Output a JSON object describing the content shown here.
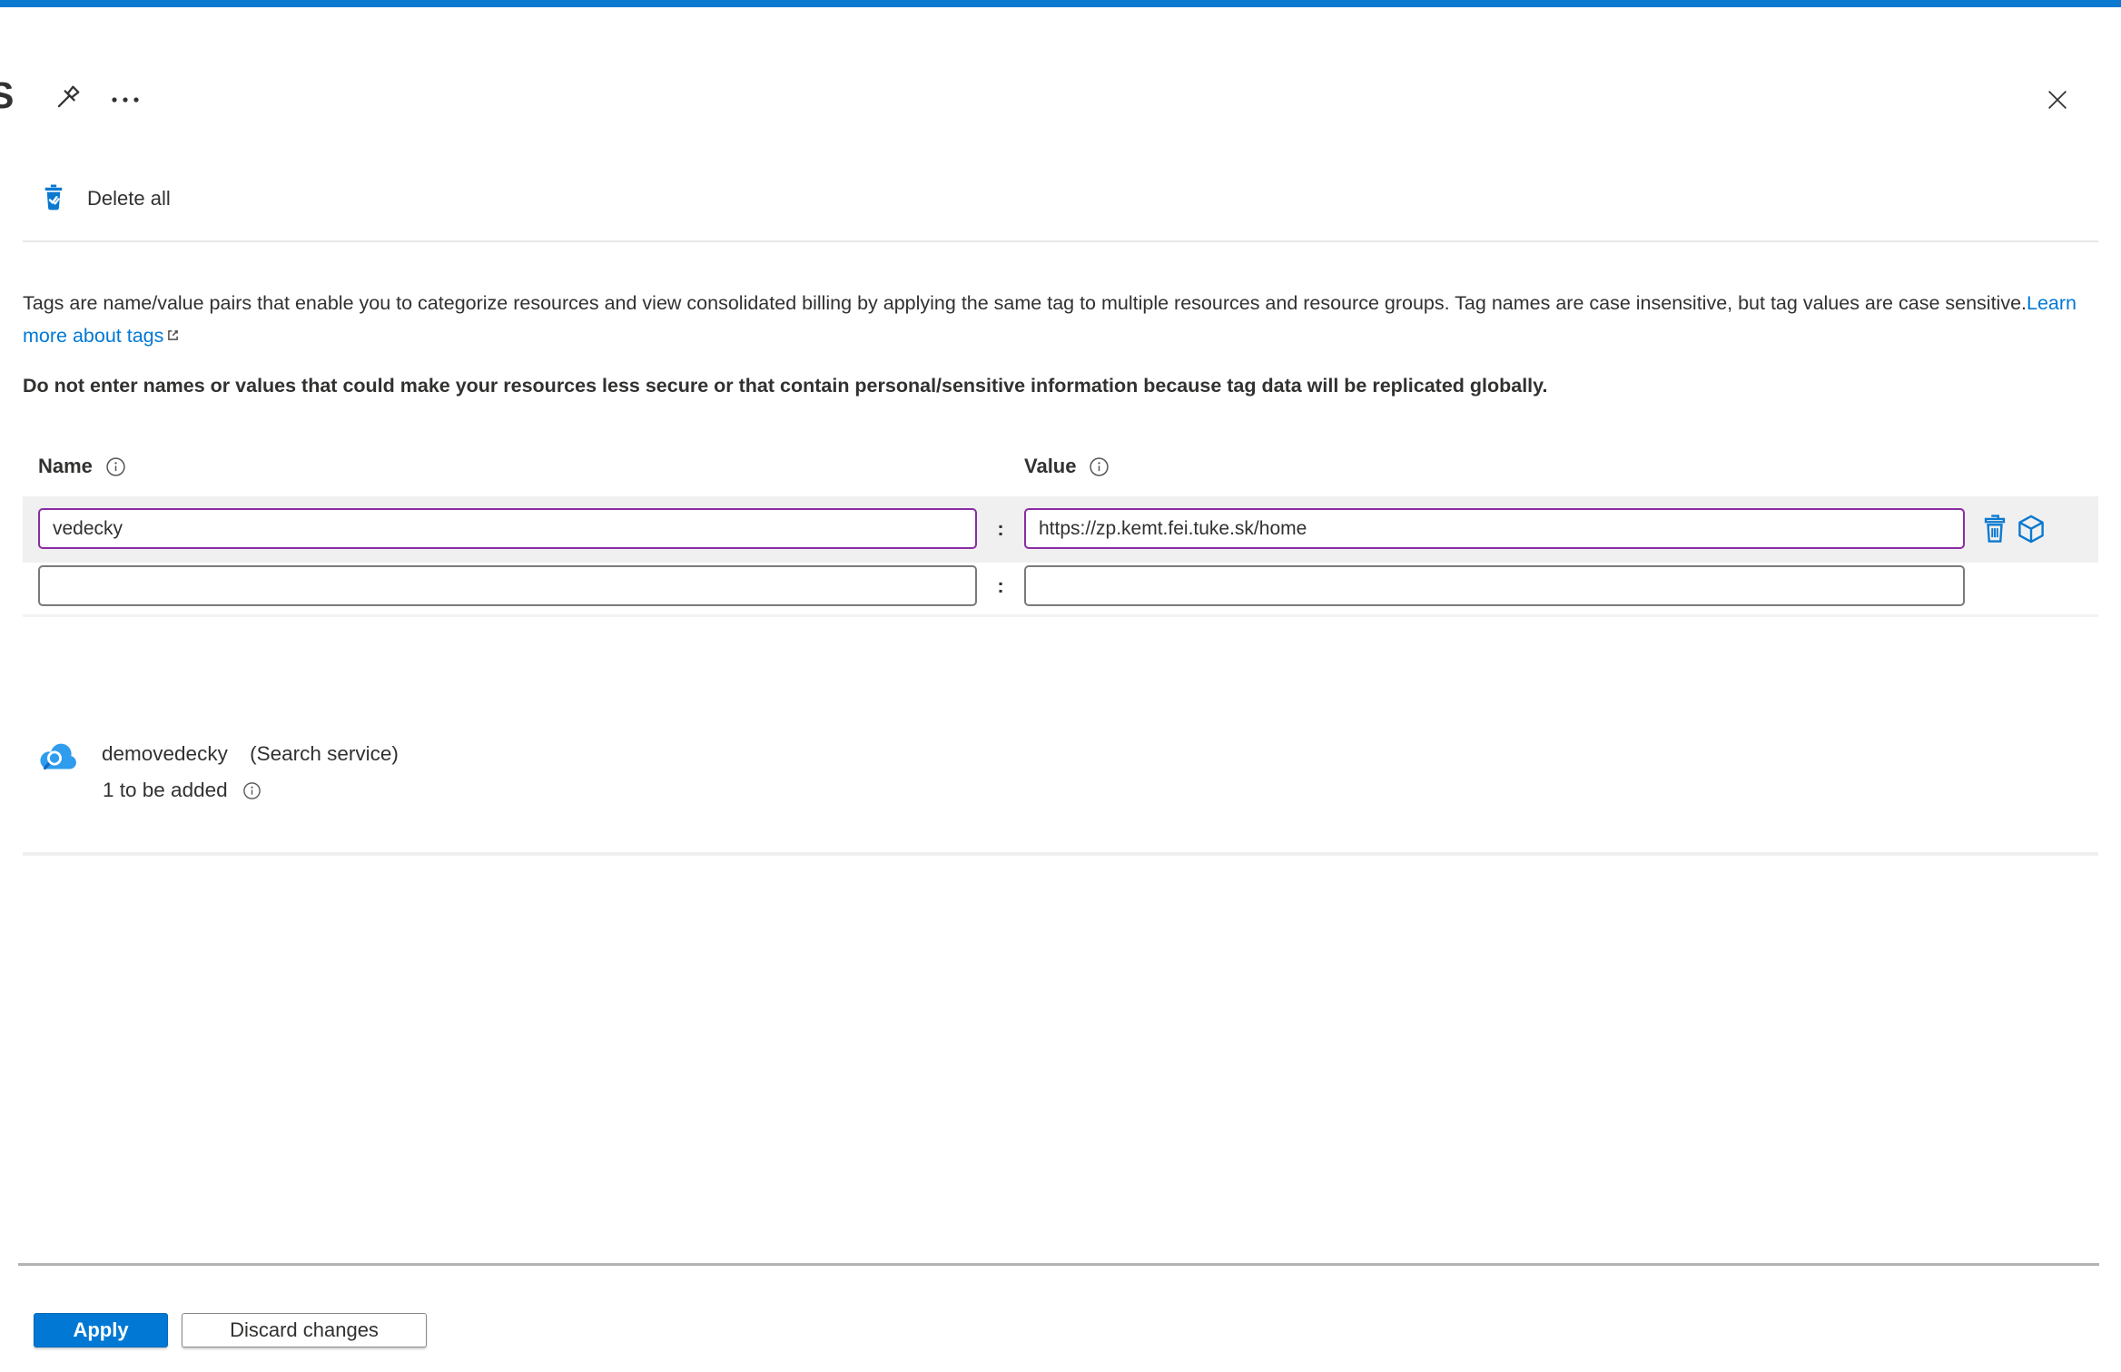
{
  "header": {
    "title_partial": "S",
    "more_icon": "ellipsis-horizontal",
    "pin_icon": "pushpin",
    "close_icon": "close-x"
  },
  "toolbar": {
    "delete_all_label": "Delete all",
    "delete_all_icon": "trash-with-checkmark"
  },
  "intro": {
    "description": "Tags are name/value pairs that enable you to categorize resources and view consolidated billing by applying the same tag to multiple resources and resource groups. Tag names are case insensitive, but tag values are case sensitive.",
    "learn_more_label": "Learn more about tags",
    "external_link_icon": "box-arrow-out",
    "warning": "Do not enter names or values that could make your resources less secure or that contain personal/sensitive information because tag data will be replicated globally."
  },
  "tag_form": {
    "name_header": "Name",
    "value_header": "Value",
    "info_icon": "info-circle",
    "separator": ":",
    "row_icons": {
      "delete": "trash-outline",
      "resource": "cube-outline"
    },
    "rows": [
      {
        "name": "vedecky",
        "value": "https://zp.kemt.fei.tuke.sk/home",
        "modified": true
      },
      {
        "name": "",
        "value": "",
        "modified": false
      }
    ]
  },
  "resource": {
    "icon": "cloud-search",
    "name": "demovedecky",
    "type": "(Search service)",
    "status": "1 to be added",
    "status_info_icon": "info-circle"
  },
  "footer": {
    "apply_label": "Apply",
    "discard_label": "Discard changes"
  },
  "colors": {
    "accent": "#0078d4",
    "modified_border": "#8a2da5",
    "text": "#323130",
    "row_band": "#f0f0f0"
  }
}
